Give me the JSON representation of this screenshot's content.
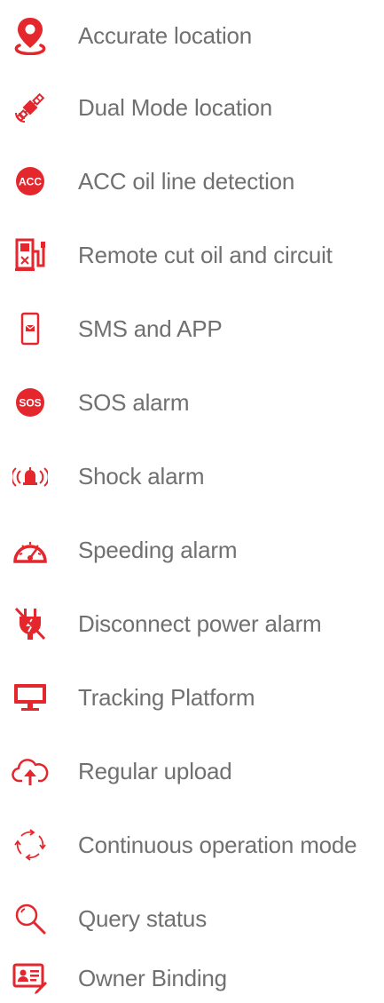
{
  "accent_color": "#e4262d",
  "text_color": "#707070",
  "features": [
    {
      "label": "Accurate location",
      "icon": "map-pin-icon"
    },
    {
      "label": "Dual Mode location",
      "icon": "satellite-icon"
    },
    {
      "label": "ACC oil line detection",
      "icon": "acc-badge-icon",
      "icon_text": "ACC"
    },
    {
      "label": "Remote cut oil and circuit",
      "icon": "fuel-pump-icon"
    },
    {
      "label": "SMS and APP",
      "icon": "smartphone-icon"
    },
    {
      "label": "SOS alarm",
      "icon": "sos-badge-icon",
      "icon_text": "SOS"
    },
    {
      "label": "Shock alarm",
      "icon": "vibrating-alarm-icon"
    },
    {
      "label": "Speeding alarm",
      "icon": "speedometer-icon"
    },
    {
      "label": "Disconnect power alarm",
      "icon": "unplugged-icon"
    },
    {
      "label": "Tracking Platform",
      "icon": "monitor-icon"
    },
    {
      "label": "Regular upload",
      "icon": "cloud-upload-icon"
    },
    {
      "label": "Continuous operation mode",
      "icon": "cycle-arrows-icon"
    },
    {
      "label": "Query status",
      "icon": "magnifier-icon"
    },
    {
      "label": "Owner Binding",
      "icon": "id-card-icon"
    }
  ]
}
